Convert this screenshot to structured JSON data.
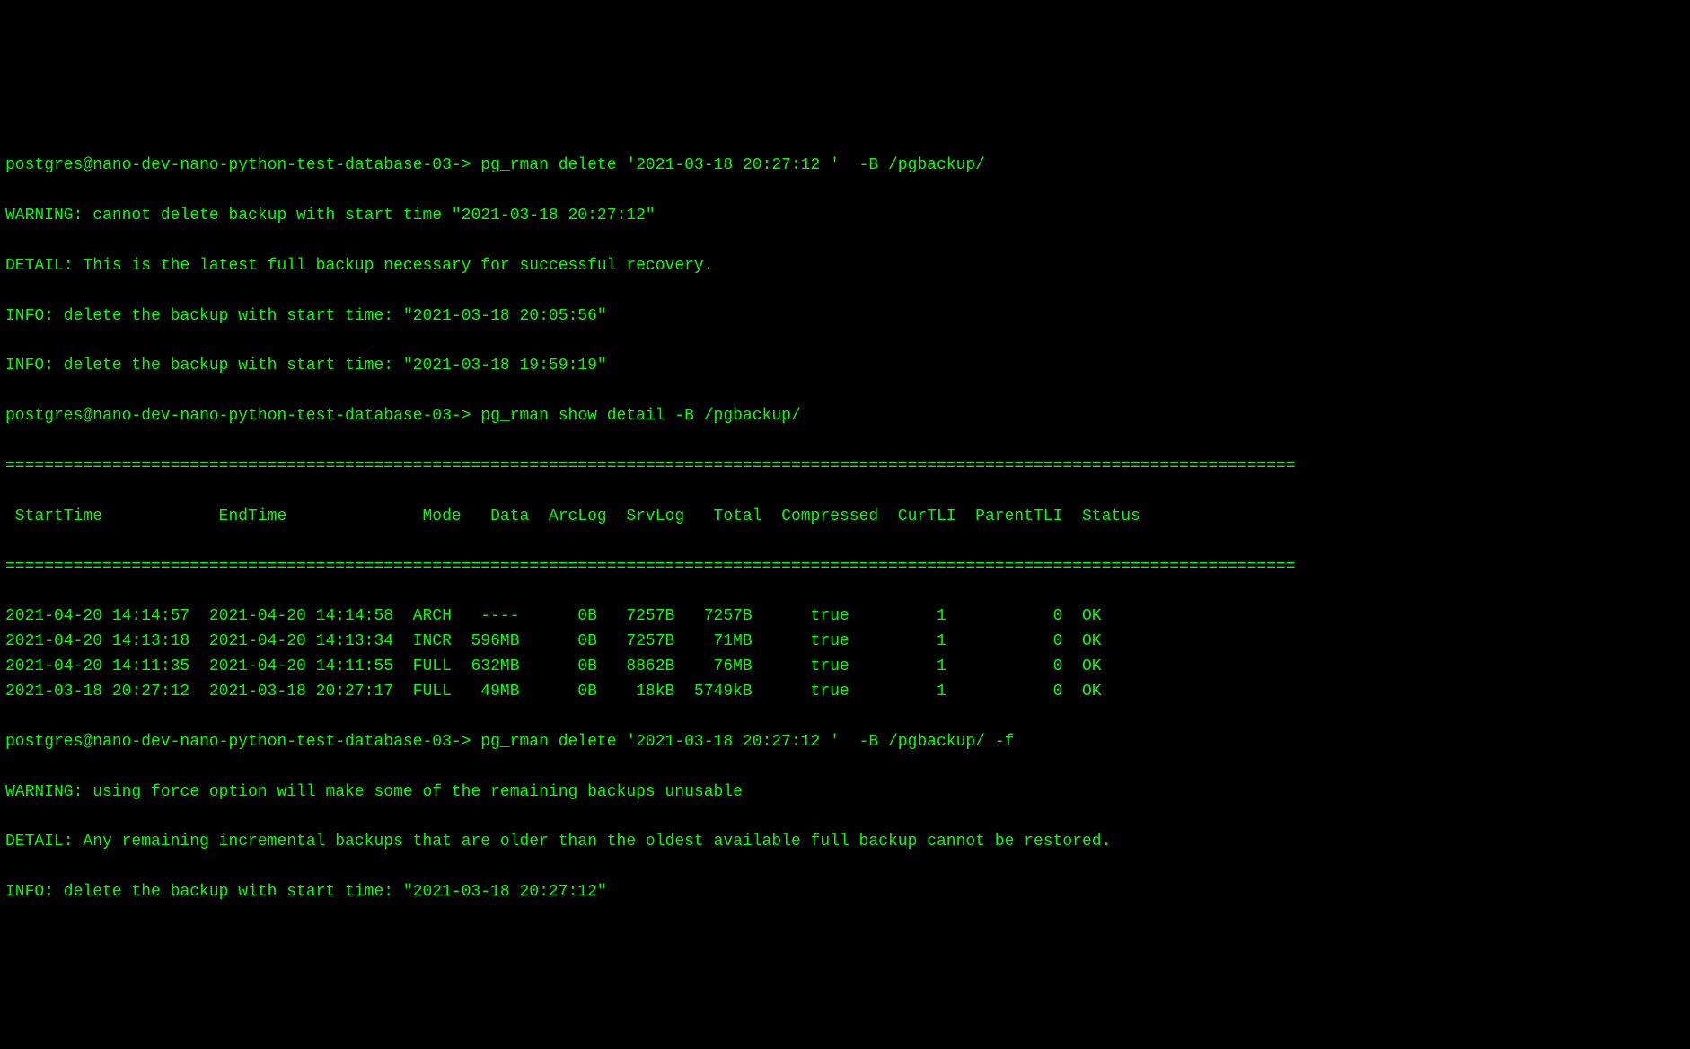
{
  "prompt": "postgres@nano-dev-nano-python-test-database-03->",
  "cmd1": "pg_rman delete '2021-03-18 20:27:12 '  -B /pgbackup/",
  "cmd2": "pg_rman show detail -B /pgbackup/",
  "cmd3": "pg_rman delete '2021-03-18 20:27:12 '  -B /pgbackup/ -f",
  "out1": {
    "warn": "WARNING: cannot delete backup with start time \"2021-03-18 20:27:12\"",
    "detail": "DETAIL: This is the latest full backup necessary for successful recovery.",
    "info1": "INFO: delete the backup with start time: \"2021-03-18 20:05:56\"",
    "info2": "INFO: delete the backup with start time: \"2021-03-18 19:59:19\""
  },
  "table": {
    "rule": "=====================================================================================================================================",
    "headers": {
      "start": "StartTime",
      "end": "EndTime",
      "mode": "Mode",
      "data": "Data",
      "arclog": "ArcLog",
      "srvlog": "SrvLog",
      "total": "Total",
      "compressed": "Compressed",
      "curtli": "CurTLI",
      "parenttli": "ParentTLI",
      "status": "Status"
    },
    "rows": [
      {
        "start": "2021-04-20 14:14:57",
        "end": "2021-04-20 14:14:58",
        "mode": "ARCH",
        "data": "----",
        "arclog": "0B",
        "srvlog": "7257B",
        "total": "7257B",
        "compressed": "true",
        "curtli": "1",
        "parenttli": "0",
        "status": "OK"
      },
      {
        "start": "2021-04-20 14:13:18",
        "end": "2021-04-20 14:13:34",
        "mode": "INCR",
        "data": "596MB",
        "arclog": "0B",
        "srvlog": "7257B",
        "total": "71MB",
        "compressed": "true",
        "curtli": "1",
        "parenttli": "0",
        "status": "OK"
      },
      {
        "start": "2021-04-20 14:11:35",
        "end": "2021-04-20 14:11:55",
        "mode": "FULL",
        "data": "632MB",
        "arclog": "0B",
        "srvlog": "8862B",
        "total": "76MB",
        "compressed": "true",
        "curtli": "1",
        "parenttli": "0",
        "status": "OK"
      },
      {
        "start": "2021-03-18 20:27:12",
        "end": "2021-03-18 20:27:17",
        "mode": "FULL",
        "data": "49MB",
        "arclog": "0B",
        "srvlog": "18kB",
        "total": "5749kB",
        "compressed": "true",
        "curtli": "1",
        "parenttli": "0",
        "status": "OK"
      }
    ]
  },
  "out3": {
    "warn": "WARNING: using force option will make some of the remaining backups unusable",
    "detail": "DETAIL: Any remaining incremental backups that are older than the oldest available full backup cannot be restored.",
    "info": "INFO: delete the backup with start time: \"2021-03-18 20:27:12\""
  }
}
